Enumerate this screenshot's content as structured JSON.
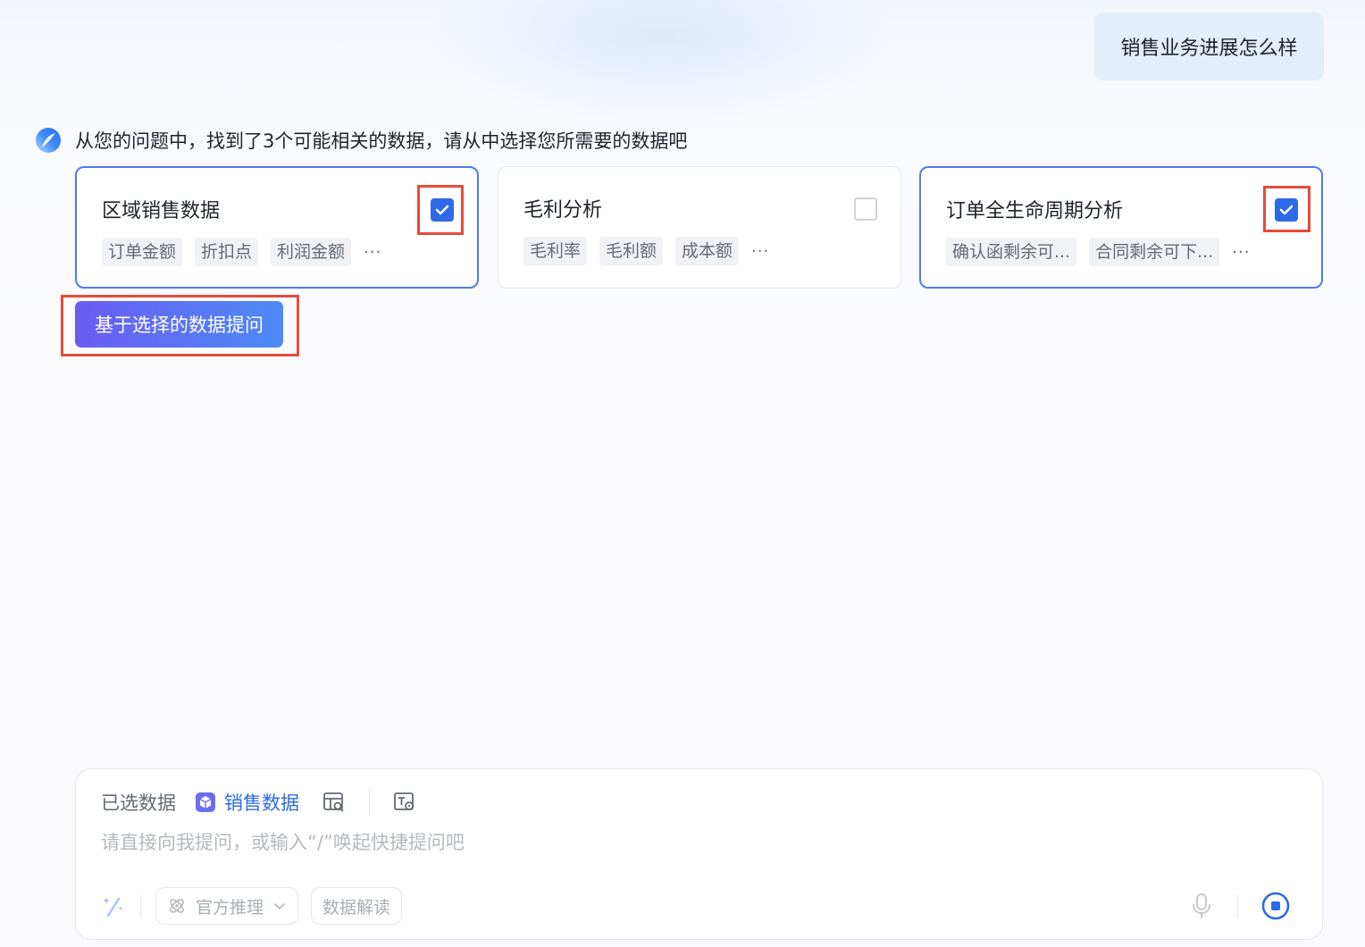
{
  "user_message": "销售业务进展怎么样",
  "assistant": {
    "message": "从您的问题中，找到了3个可能相关的数据，请从中选择您所需要的数据吧"
  },
  "cards": [
    {
      "title": "区域销售数据",
      "tags": [
        "订单金额",
        "折扣点",
        "利润金额"
      ],
      "more": "···",
      "checked": true
    },
    {
      "title": "毛利分析",
      "tags": [
        "毛利率",
        "毛利额",
        "成本额"
      ],
      "more": "···",
      "checked": false
    },
    {
      "title": "订单全生命周期分析",
      "tags": [
        "确认函剩余可...",
        "合同剩余可下..."
      ],
      "more": "···",
      "checked": true
    }
  ],
  "ask_button_label": "基于选择的数据提问",
  "input_panel": {
    "selected_label": "已选数据",
    "dataset_name": "销售数据",
    "placeholder": "请直接向我提问，或输入“/”唤起快捷提问吧",
    "mode_label": "官方推理",
    "interpret_label": "数据解读"
  },
  "colors": {
    "accent": "#2e6ae6",
    "selected_border": "#4f7bf0",
    "highlight": "#e64b3c",
    "button_gradient_start": "#6a5cf2",
    "button_gradient_end": "#4c8bf5"
  }
}
